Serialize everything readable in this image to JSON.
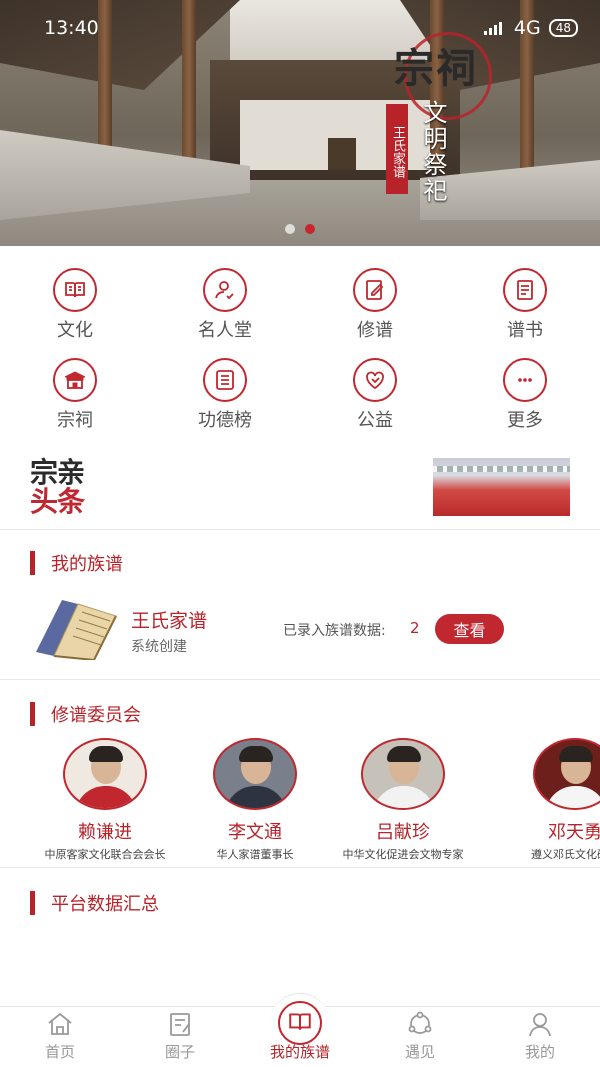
{
  "status": {
    "time": "13:40",
    "network": "4G",
    "battery": "48"
  },
  "banner": {
    "title_big": "宗祠",
    "seal": "王氏家谱",
    "subtitle": "文明祭祀",
    "dots": 2,
    "active_dot": 1
  },
  "grid": [
    {
      "label": "文化",
      "icon": "book-icon"
    },
    {
      "label": "名人堂",
      "icon": "person-check-icon"
    },
    {
      "label": "修谱",
      "icon": "edit-icon"
    },
    {
      "label": "谱书",
      "icon": "document-icon"
    },
    {
      "label": "宗祠",
      "icon": "temple-icon"
    },
    {
      "label": "功德榜",
      "icon": "list-icon"
    },
    {
      "label": "公益",
      "icon": "heart-icon"
    },
    {
      "label": "更多",
      "icon": "more-icon"
    }
  ],
  "news": {
    "logo_line1": "宗亲",
    "logo_line2": "头条"
  },
  "my_family": {
    "section_title": "我的族谱",
    "name": "王氏家谱",
    "sub": "系统创建",
    "count_label": "已录入族谱数据:",
    "count": "2",
    "view_button": "查看"
  },
  "committee": {
    "section_title": "修谱委员会",
    "members": [
      {
        "name": "赖谦进",
        "title": "中原客家文化联合会会长",
        "body_color": "#c0272f",
        "bg": "#efe9e2"
      },
      {
        "name": "李文通",
        "title": "华人家谱董事长",
        "body_color": "#2d3340",
        "bg": "#7a7f8c"
      },
      {
        "name": "吕献珍",
        "title": "中华文化促进会文物专家",
        "body_color": "#f2f2f2",
        "bg": "#c7c2b9"
      },
      {
        "name": "邓天勇",
        "title": "遵义邓氏文化研究",
        "body_color": "#f5f5f5",
        "bg": "#6d1f1c"
      }
    ]
  },
  "stats": {
    "section_title": "平台数据汇总"
  },
  "tabbar": [
    {
      "label": "首页",
      "icon": "home-icon"
    },
    {
      "label": "圈子",
      "icon": "circle-post-icon"
    },
    {
      "label": "我的族谱",
      "icon": "family-book-icon"
    },
    {
      "label": "遇见",
      "icon": "meet-icon"
    },
    {
      "label": "我的",
      "icon": "user-icon"
    }
  ],
  "colors": {
    "accent": "#c0272f"
  }
}
